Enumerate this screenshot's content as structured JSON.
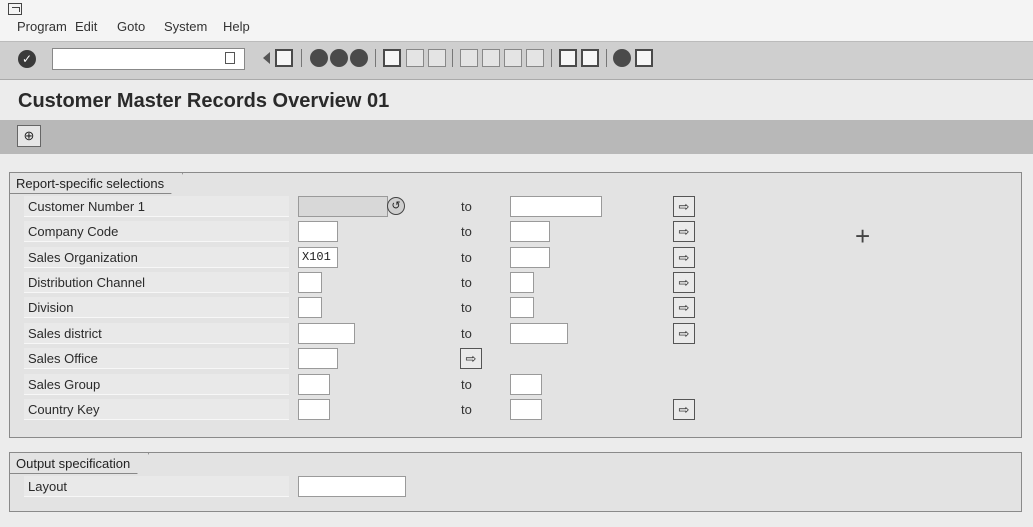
{
  "menu": [
    {
      "label": "Program",
      "underline": "P"
    },
    {
      "label": "Edit",
      "underline": "E"
    },
    {
      "label": "Goto",
      "underline": "G"
    },
    {
      "label": "System",
      "underline": "S"
    },
    {
      "label": "Help",
      "underline": "H"
    }
  ],
  "toolbar": {
    "enter_icon": "✓",
    "command_value": "",
    "icons": [
      "back-icon",
      "save-icon",
      "back-nav-icon",
      "exit-icon",
      "cancel-icon",
      "print-icon",
      "find-icon",
      "find-next-icon",
      "first-page-icon",
      "previous-page-icon",
      "next-page-icon",
      "last-page-icon",
      "create-session-icon",
      "shortcut-icon",
      "help-icon",
      "layout-icon"
    ]
  },
  "page_title": "Customer Master Records Overview 01",
  "app_toolbar": {
    "execute_icon": "⊕"
  },
  "selections": {
    "title": "Report-specific selections",
    "to_label": "to",
    "rows": [
      {
        "label": "Customer Number 1",
        "from": "",
        "to_label": "to",
        "to": ""
      },
      {
        "label": "Company Code",
        "from": "",
        "to_label": "to",
        "to": ""
      },
      {
        "label": "Sales Organization",
        "from": "X101",
        "to_label": "to",
        "to": ""
      },
      {
        "label": "Distribution Channel",
        "from": "",
        "to_label": "to",
        "to": ""
      },
      {
        "label": "Division",
        "from": "",
        "to_label": "to",
        "to": ""
      },
      {
        "label": "Sales district",
        "from": "",
        "to_label": "to",
        "to": ""
      },
      {
        "label": "Sales Office",
        "from": ""
      },
      {
        "label": "Sales Group",
        "from": "",
        "to_label": "to",
        "to": ""
      },
      {
        "label": "Country Key",
        "from": "",
        "to_label": "to",
        "to": ""
      }
    ],
    "arrow_glyph": "⇨"
  },
  "output": {
    "title": "Output specification",
    "layout_label": "Layout",
    "layout_value": ""
  }
}
